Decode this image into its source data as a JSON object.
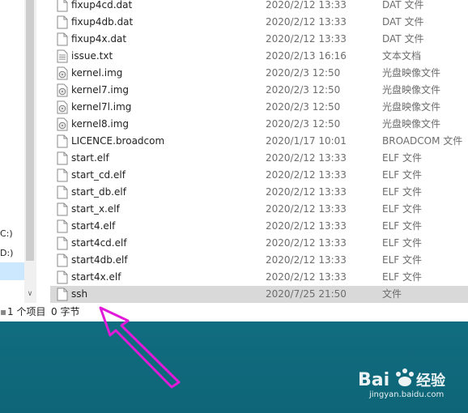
{
  "nav": {
    "drive_c": "C:)",
    "drive_d": "D:)"
  },
  "files": [
    {
      "name": "fixup4cd.dat",
      "date": "2020/2/12 13:33",
      "type": "DAT 文件",
      "icon": "file-icon"
    },
    {
      "name": "fixup4db.dat",
      "date": "2020/2/12 13:33",
      "type": "DAT 文件",
      "icon": "file-icon"
    },
    {
      "name": "fixup4x.dat",
      "date": "2020/2/12 13:33",
      "type": "DAT 文件",
      "icon": "file-icon"
    },
    {
      "name": "issue.txt",
      "date": "2020/2/13 16:16",
      "type": "文本文档",
      "icon": "text-file-icon"
    },
    {
      "name": "kernel.img",
      "date": "2020/2/3 12:50",
      "type": "光盘映像文件",
      "icon": "disc-image-icon"
    },
    {
      "name": "kernel7.img",
      "date": "2020/2/3 12:50",
      "type": "光盘映像文件",
      "icon": "disc-image-icon"
    },
    {
      "name": "kernel7l.img",
      "date": "2020/2/3 12:50",
      "type": "光盘映像文件",
      "icon": "disc-image-icon"
    },
    {
      "name": "kernel8.img",
      "date": "2020/2/3 12:50",
      "type": "光盘映像文件",
      "icon": "disc-image-icon"
    },
    {
      "name": "LICENCE.broadcom",
      "date": "2020/1/17 10:01",
      "type": "BROADCOM 文件",
      "icon": "file-icon"
    },
    {
      "name": "start.elf",
      "date": "2020/2/12 13:33",
      "type": "ELF 文件",
      "icon": "file-icon"
    },
    {
      "name": "start_cd.elf",
      "date": "2020/2/12 13:33",
      "type": "ELF 文件",
      "icon": "file-icon"
    },
    {
      "name": "start_db.elf",
      "date": "2020/2/12 13:33",
      "type": "ELF 文件",
      "icon": "file-icon"
    },
    {
      "name": "start_x.elf",
      "date": "2020/2/12 13:33",
      "type": "ELF 文件",
      "icon": "file-icon"
    },
    {
      "name": "start4.elf",
      "date": "2020/2/12 13:33",
      "type": "ELF 文件",
      "icon": "file-icon"
    },
    {
      "name": "start4cd.elf",
      "date": "2020/2/12 13:33",
      "type": "ELF 文件",
      "icon": "file-icon"
    },
    {
      "name": "start4db.elf",
      "date": "2020/2/12 13:33",
      "type": "ELF 文件",
      "icon": "file-icon"
    },
    {
      "name": "start4x.elf",
      "date": "2020/2/12 13:33",
      "type": "ELF 文件",
      "icon": "file-icon"
    },
    {
      "name": "ssh",
      "date": "2020/7/25 21:50",
      "type": "文件",
      "icon": "file-icon",
      "selected": true
    }
  ],
  "status": {
    "item_count": "1 个项目",
    "selected_size": "0 字节"
  },
  "watermark": {
    "brand": "Bai 经验",
    "url": "jingyan.baidu.com"
  },
  "colors": {
    "selected_row": "#d9d9d9",
    "annotation_arrow": "#e11ad9"
  }
}
